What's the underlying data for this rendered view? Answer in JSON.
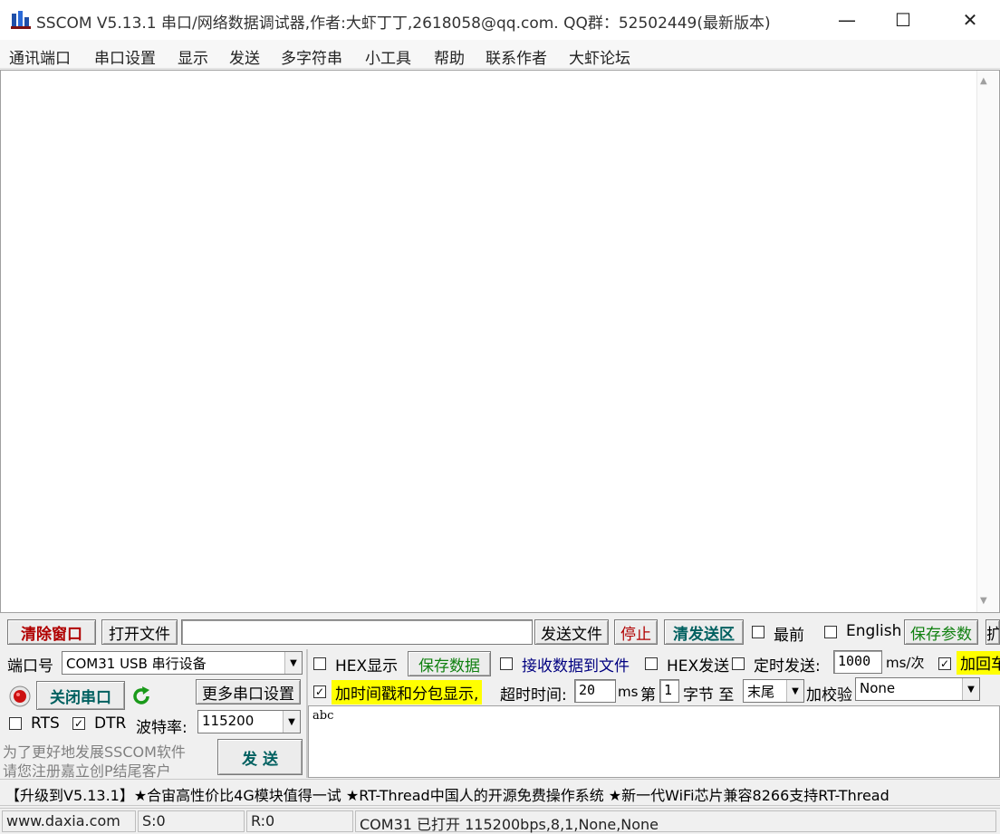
{
  "window": {
    "title": "SSCOM V5.13.1 串口/网络数据调试器,作者:大虾丁丁,2618058@qq.com. QQ群：52502449(最新版本)",
    "minimize_glyph": "—",
    "maximize_glyph": "☐",
    "close_glyph": "✕"
  },
  "menu": [
    "通讯端口",
    "串口设置",
    "显示",
    "发送",
    "多字符串",
    "小工具",
    "帮助",
    "联系作者",
    "大虾论坛"
  ],
  "receive_area": {
    "content": "",
    "scroll_up": "▲",
    "scroll_down": "▼"
  },
  "toolbar": {
    "clear_window": "清除窗口",
    "open_file": "打开文件",
    "file_path": "",
    "send_file": "发送文件",
    "stop": "停止",
    "clear_send": "清发送区",
    "topmost_label": "最前",
    "topmost_checked": false,
    "english_label": "English",
    "english_checked": false,
    "save_params": "保存参数",
    "expand": "扩"
  },
  "port": {
    "port_label": "端口号",
    "port_value": "COM31 USB 串行设备",
    "close_port": "关闭串口",
    "more_settings": "更多串口设置",
    "rts_label": "RTS",
    "rts_checked": false,
    "dtr_label": "DTR",
    "dtr_checked": true,
    "baud_label": "波特率:",
    "baud_value": "115200",
    "promo_line1": "为了更好地发展SSCOM软件",
    "promo_line2": "请您注册嘉立创P结尾客户",
    "send_button": "发 送"
  },
  "options": {
    "hex_display": "HEX显示",
    "hex_display_checked": false,
    "save_data": "保存数据",
    "recv_to_file": "接收数据到文件",
    "recv_to_file_checked": false,
    "hex_send": "HEX发送",
    "hex_send_checked": false,
    "timed_send": "定时发送:",
    "timed_send_checked": false,
    "interval_value": "1000",
    "interval_unit": "ms/次",
    "add_crlf": "加回车",
    "add_crlf_checked": true,
    "timestamp": "加时间戳和分包显示,",
    "timestamp_checked": true,
    "timeout_label": "超时时间:",
    "timeout_value": "20",
    "timeout_unit": "ms",
    "byte_prefix": "第",
    "byte_index": "1",
    "byte_suffix": "字节 至",
    "byte_end": "末尾",
    "checksum_label": "加校验",
    "checksum_value": "None"
  },
  "send_area": {
    "content": "abc"
  },
  "ticker": "【升级到V5.13.1】★合宙高性价比4G模块值得一试 ★RT-Thread中国人的开源免费操作系统 ★新一代WiFi芯片兼容8266支持RT-Thread",
  "status_bar": {
    "website": "www.daxia.com",
    "sent": "S:0",
    "received": "R:0",
    "port_status": "COM31 已打开  115200bps,8,1,None,None"
  },
  "colors": {
    "clear_window_text": "#b00000",
    "save_green": "#108010",
    "recv_file_blue": "#000080",
    "highlight_yellow": "#ffff00",
    "close_port_teal": "#006060",
    "refresh_green": "#1a9a1a"
  }
}
